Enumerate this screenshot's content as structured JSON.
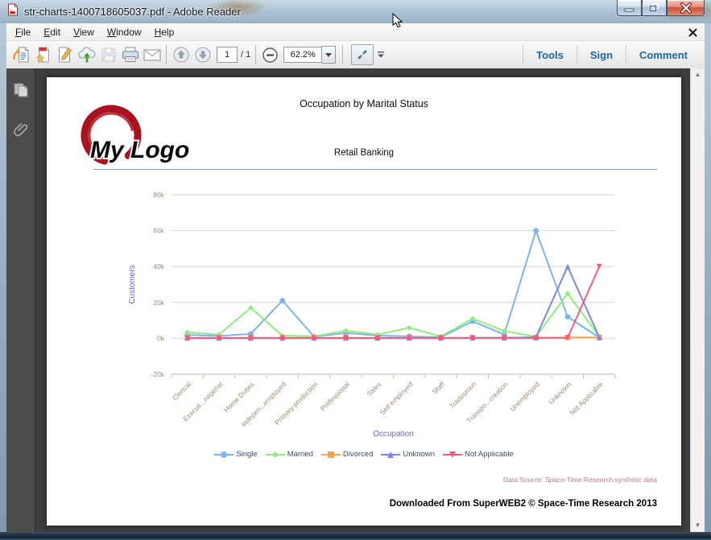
{
  "window": {
    "title": "str-charts-1400718605037.pdf - Adobe Reader"
  },
  "menu": {
    "items": [
      "File",
      "Edit",
      "View",
      "Window",
      "Help"
    ]
  },
  "toolbar": {
    "page_current": "1",
    "page_total": "/ 1",
    "zoom_value": "62.2%",
    "tools_label": "Tools",
    "sign_label": "Sign",
    "comment_label": "Comment"
  },
  "icons": {
    "titlebar": [
      "pdf-file-icon",
      "minimize-icon",
      "restore-icon",
      "close-icon"
    ],
    "menubar": [
      "close-document-icon"
    ],
    "toolbar": [
      "open-icon",
      "create-pdf-icon",
      "sign-document-icon",
      "cloud-upload-icon",
      "save-icon",
      "print-icon",
      "email-icon",
      "page-up-icon",
      "page-down-icon",
      "zoom-out-icon",
      "zoom-dropdown-icon",
      "fit-page-icon",
      "toolbar-options-icon"
    ],
    "sidebar": [
      "page-thumbnails-icon",
      "attachments-icon"
    ],
    "scrollbar": [
      "scroll-up-icon",
      "scroll-down-icon"
    ]
  },
  "page": {
    "logo_text": "My Logo",
    "header_title": "Occupation by Marital Status",
    "subtitle": "Retail Banking",
    "data_source": "Data Source: Space-Time Research synthetic data",
    "footer": "Downloaded From SuperWEB2 © Space-Time Research 2013"
  },
  "colors": {
    "toolbar_link": "#1a66ad",
    "axis_title": "#6b65c9",
    "tick_text": "#9c8b79",
    "grid": "#ddd2c9",
    "axis_line": "#c7b9ad",
    "legend_text": "#3e4a63",
    "data_source_text": "#b97b85",
    "divider": "#7d9cc0"
  },
  "chart_data": {
    "type": "line",
    "title": "Occupation by Marital Status",
    "subtitle": "Retail Banking",
    "xlabel": "Occupation",
    "ylabel": "Customers",
    "ylim": [
      -20000,
      80000
    ],
    "grid": true,
    "legend_position": "bottom",
    "yticks": [
      {
        "label": "80k",
        "value": 80000
      },
      {
        "label": "60k",
        "value": 60000
      },
      {
        "label": "40k",
        "value": 40000
      },
      {
        "label": "20k",
        "value": 20000
      },
      {
        "label": "0k",
        "value": 0
      },
      {
        "label": "-20k",
        "value": -20000
      }
    ],
    "categories": [
      "Clerical",
      "Executi...nagerial",
      "Home Duties",
      "Indepen...employed",
      "Primary production",
      "Professional",
      "Sales",
      "Self employed",
      "Staff",
      "Tradesmen",
      "Transpo...creation",
      "Unemployed",
      "Unknown",
      "Not Applicable"
    ],
    "series": [
      {
        "name": "Single",
        "color": "#7cb5ec",
        "marker": "circle",
        "values": [
          2000,
          1300,
          2500,
          21000,
          900,
          3000,
          1600,
          1100,
          600,
          9500,
          2100,
          60000,
          12000,
          400
        ]
      },
      {
        "name": "Married",
        "color": "#90ed7d",
        "marker": "diamond",
        "values": [
          3400,
          2100,
          17000,
          1500,
          1100,
          4300,
          2100,
          5900,
          1100,
          11000,
          4100,
          900,
          25000,
          1000
        ]
      },
      {
        "name": "Divorced",
        "color": "#f7a35c",
        "marker": "square",
        "values": [
          300,
          300,
          300,
          300,
          300,
          300,
          300,
          300,
          300,
          300,
          300,
          300,
          500,
          500
        ]
      },
      {
        "name": "Unknown",
        "color": "#8085e9",
        "marker": "triangle",
        "values": [
          200,
          200,
          200,
          200,
          200,
          200,
          200,
          200,
          200,
          300,
          300,
          600,
          40000,
          500
        ]
      },
      {
        "name": "Not Applicable",
        "color": "#f15c80",
        "marker": "triangle-down",
        "values": [
          150,
          150,
          150,
          150,
          150,
          150,
          150,
          150,
          150,
          200,
          200,
          250,
          300,
          40000
        ]
      }
    ]
  }
}
